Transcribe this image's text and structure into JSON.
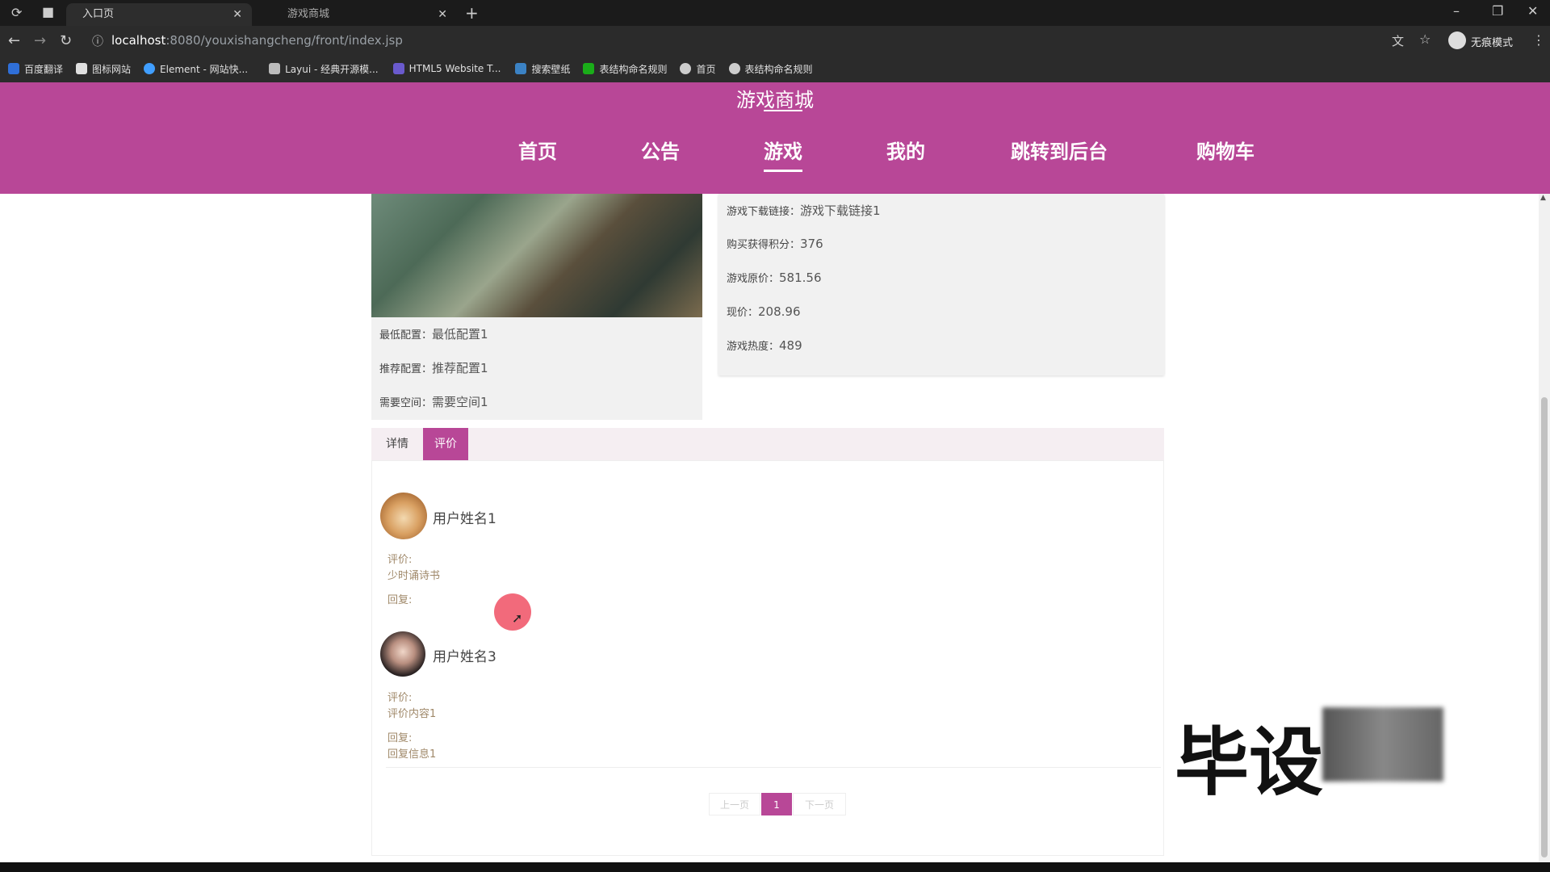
{
  "browser": {
    "tabs": [
      {
        "label": "入口页"
      },
      {
        "label": "游戏商城"
      }
    ],
    "new_tab": "+",
    "url_host": "localhost",
    "url_rest": ":8080/youxishangcheng/front/index.jsp",
    "incognito_label": "无痕模式",
    "bookmarks": [
      {
        "label": "百度翻译",
        "color": "#2f6fd8"
      },
      {
        "label": "图标网站",
        "color": "#e0e0e0"
      },
      {
        "label": "Element - 网站快...",
        "color": "#409eff"
      },
      {
        "label": "Layui - 经典开源模...",
        "color": "#bbbbbb"
      },
      {
        "label": "HTML5 Website T...",
        "color": "#6a5acd"
      },
      {
        "label": "搜索壁纸",
        "color": "#3b82c4"
      },
      {
        "label": "表结构命名规则",
        "color": "#1aad19"
      },
      {
        "label": "首页",
        "color": "#cccccc"
      },
      {
        "label": "表结构命名规则",
        "color": "#cccccc"
      }
    ]
  },
  "site": {
    "title": "游戏商城",
    "nav": [
      "首页",
      "公告",
      "游戏",
      "我的",
      "跳转到后台",
      "购物车"
    ],
    "active_nav": "游戏",
    "brand_color": "#b84797"
  },
  "game": {
    "left_fields": [
      {
        "k": "最低配置：",
        "v": "最低配置1"
      },
      {
        "k": "推荐配置：",
        "v": "推荐配置1"
      },
      {
        "k": "需要空间：",
        "v": "需要空间1"
      }
    ],
    "right_fields": [
      {
        "k": "游戏下载链接：",
        "v": "游戏下载链接1"
      },
      {
        "k": "购买获得积分：",
        "v": "376"
      },
      {
        "k": "游戏原价：",
        "v": "581.56"
      },
      {
        "k": "现价：",
        "v": "208.96"
      },
      {
        "k": "游戏热度：",
        "v": "489"
      }
    ]
  },
  "detail_tabs": [
    "详情",
    "评价"
  ],
  "active_detail_tab": "评价",
  "reviews": [
    {
      "user": "用户姓名1",
      "review_label": "评价:",
      "review": "少时诵诗书",
      "reply_label": "回复:",
      "reply": ""
    },
    {
      "user": "用户姓名3",
      "review_label": "评价:",
      "review": "评价内容1",
      "reply_label": "回复:",
      "reply": "回复信息1"
    }
  ],
  "pager": {
    "prev": "上一页",
    "page": "1",
    "next": "下一页"
  },
  "watermark": "毕设"
}
